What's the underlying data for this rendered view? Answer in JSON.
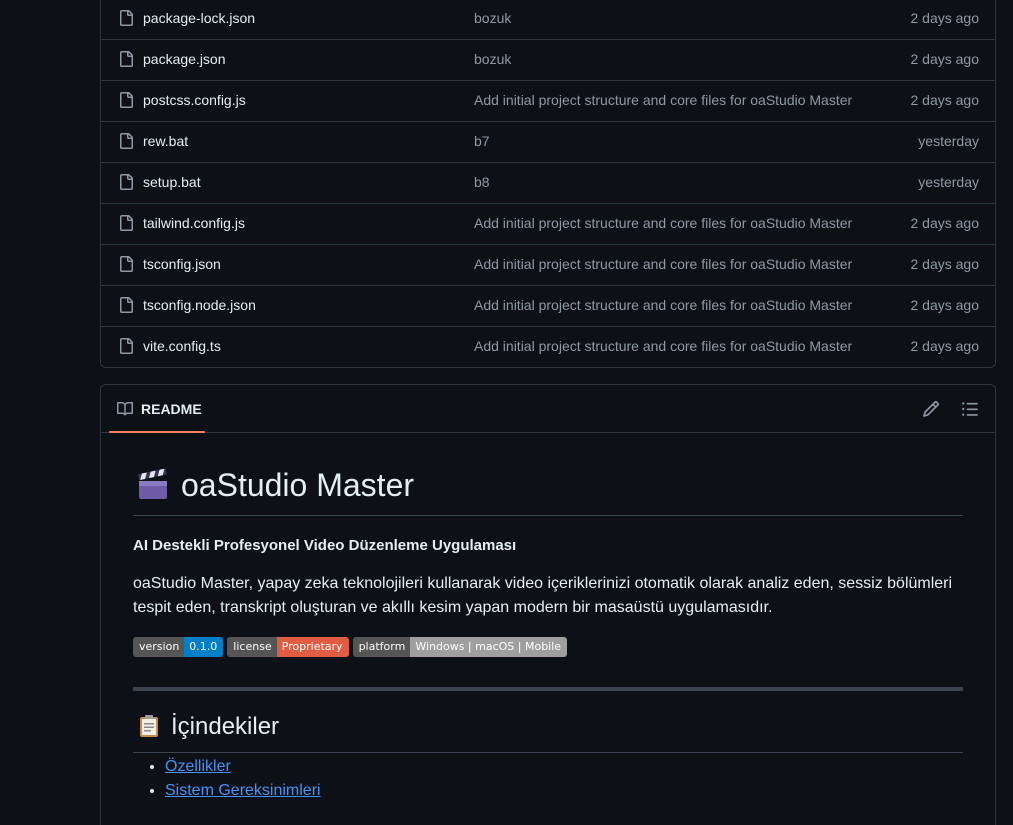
{
  "files": [
    {
      "name": "package-lock.json",
      "message": "bozuk",
      "time": "2 days ago"
    },
    {
      "name": "package.json",
      "message": "bozuk",
      "time": "2 days ago"
    },
    {
      "name": "postcss.config.js",
      "message": "Add initial project structure and core files for oaStudio Master",
      "time": "2 days ago"
    },
    {
      "name": "rew.bat",
      "message": "b7",
      "time": "yesterday"
    },
    {
      "name": "setup.bat",
      "message": "b8",
      "time": "yesterday"
    },
    {
      "name": "tailwind.config.js",
      "message": "Add initial project structure and core files for oaStudio Master",
      "time": "2 days ago"
    },
    {
      "name": "tsconfig.json",
      "message": "Add initial project structure and core files for oaStudio Master",
      "time": "2 days ago"
    },
    {
      "name": "tsconfig.node.json",
      "message": "Add initial project structure and core files for oaStudio Master",
      "time": "2 days ago"
    },
    {
      "name": "vite.config.ts",
      "message": "Add initial project structure and core files for oaStudio Master",
      "time": "2 days ago"
    }
  ],
  "readme": {
    "tab_label": "README",
    "title": "oaStudio Master",
    "subtitle": "AI Destekli Profesyonel Video Düzenleme Uygulaması",
    "description": "oaStudio Master, yapay zeka teknolojileri kullanarak video içeriklerinizi otomatik olarak analiz eden, sessiz bölümleri tespit eden, transkript oluşturan ve akıllı kesim yapan modern bir masaüstü uygulamasıdır.",
    "badges": [
      {
        "key": "version",
        "value": "0.1.0",
        "color": "#007ec6"
      },
      {
        "key": "license",
        "value": "Proprietary",
        "color": "#e05d44"
      },
      {
        "key": "platform",
        "value": "Windows | macOS | Mobile",
        "color": "#9f9f9f"
      }
    ],
    "toc_title": "İçindekiler",
    "toc_items": [
      "Özellikler",
      "Sistem Gereksinimleri"
    ]
  },
  "colors": {
    "background": "#0d1117",
    "border": "#30363d",
    "muted_text": "#9198a1",
    "link": "#4493f8",
    "tab_underline": "#f78166"
  }
}
